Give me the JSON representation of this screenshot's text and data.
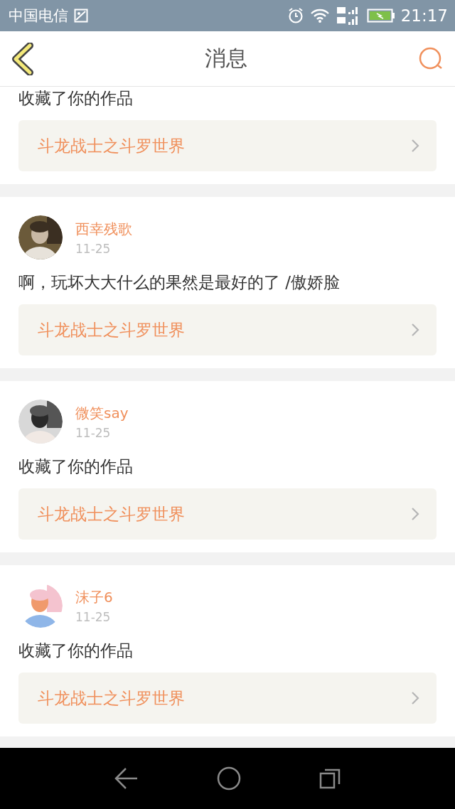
{
  "status_bar": {
    "carrier": "中国电信",
    "time": "21:17"
  },
  "header": {
    "title": "消息"
  },
  "messages": [
    {
      "comment": "收藏了你的作品",
      "work_title": "斗龙战士之斗罗世界"
    },
    {
      "user": "西幸残歌",
      "date": "11-25",
      "comment": "啊，玩坏大大什么的果然是最好的了 /傲娇脸",
      "work_title": "斗龙战士之斗罗世界"
    },
    {
      "user": "微笑say",
      "date": "11-25",
      "comment": "收藏了你的作品",
      "work_title": "斗龙战士之斗罗世界"
    },
    {
      "user": "沫子6",
      "date": "11-25",
      "comment": "收藏了你的作品",
      "work_title": "斗龙战士之斗罗世界"
    }
  ]
}
